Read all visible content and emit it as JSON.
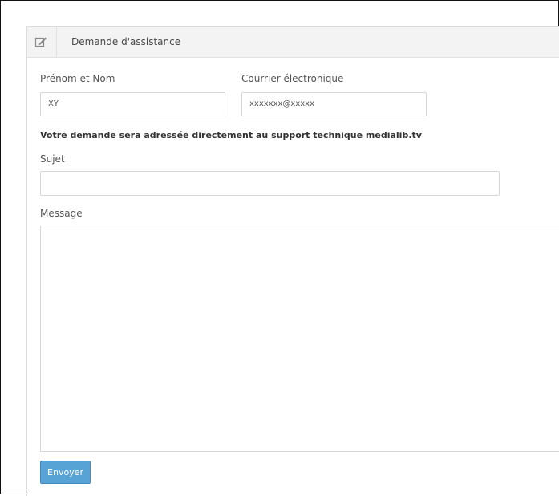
{
  "panel": {
    "title": "Demande d'assistance",
    "icon": "edit-icon"
  },
  "form": {
    "name_label": "Prénom et Nom",
    "name_value": "XY",
    "email_label": "Courrier électronique",
    "email_value": "xxxxxxx@xxxxx",
    "info_text": "Votre demande sera adressée directement au support technique medialib.tv",
    "subject_label": "Sujet",
    "subject_value": "",
    "message_label": "Message",
    "message_value": "",
    "submit_label": "Envoyer"
  },
  "colors": {
    "header_bg": "#f3f3f3",
    "button_bg": "#58a3d6",
    "border": "#d7d7d7"
  }
}
